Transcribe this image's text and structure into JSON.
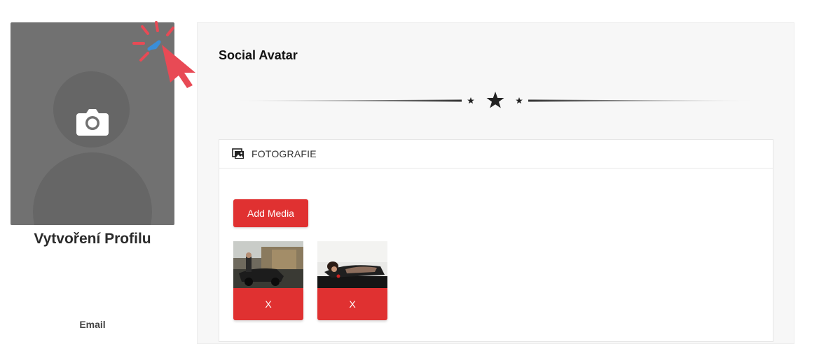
{
  "sidebar": {
    "profile_title": "Vytvoření Profilu",
    "email_label": "Email"
  },
  "panel": {
    "title": "Social Avatar",
    "media_header": "FOTOGRAFIE",
    "add_media_label": "Add Media",
    "thumbnails": [
      {
        "remove_label": "X"
      },
      {
        "remove_label": "X"
      }
    ]
  },
  "colors": {
    "accent_red": "#e03131",
    "avatar_gray": "#717171",
    "panel_bg": "#f7f7f7"
  },
  "icons": [
    "camera-icon",
    "click-cursor-icon",
    "photos-icon",
    "star-icon"
  ]
}
